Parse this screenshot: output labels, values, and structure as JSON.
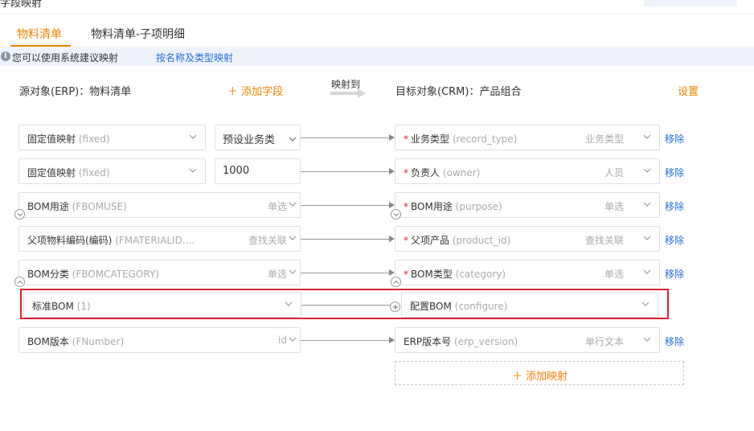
{
  "top": {
    "partial_title": "字段映射"
  },
  "tabs": [
    {
      "label": "物料清单",
      "active": true
    },
    {
      "label": "物料清单-子项明细",
      "active": false
    }
  ],
  "info": {
    "text": "您可以使用系统建议映射",
    "link": "按名称及类型映射"
  },
  "header": {
    "source": "源对象(ERP)：物料清单",
    "add_field": "＋ 添加字段",
    "mapping_to": "映射到",
    "target": "目标对象(CRM)：产品组合",
    "settings": "设置"
  },
  "rows": [
    {
      "src_label": "固定值映射",
      "src_api": "(fixed)",
      "src_type": "",
      "fixed_value": "预设业务类",
      "fixed_is_select": true,
      "tgt_required": true,
      "tgt_label": "业务类型",
      "tgt_api": "(record_type)",
      "tgt_type": "业务类型",
      "remove": "移除"
    },
    {
      "src_label": "固定值映射",
      "src_api": "(fixed)",
      "src_type": "",
      "fixed_value": "1000",
      "fixed_is_select": false,
      "tgt_required": true,
      "tgt_label": "负责人",
      "tgt_api": "(owner)",
      "tgt_type": "人员",
      "remove": "移除"
    },
    {
      "src_label": "BOM用途",
      "src_api": "(FBOMUSE)",
      "src_type": "单选",
      "tgt_required": true,
      "tgt_label": "BOM用途",
      "tgt_api": "(purpose)",
      "tgt_type": "单选",
      "remove": "移除"
    },
    {
      "src_label": "父项物料编码(编码)",
      "src_api": "(FMATERIALID....",
      "src_type": "查找关联",
      "tgt_required": true,
      "tgt_label": "父项产品",
      "tgt_api": "(product_id)",
      "tgt_type": "查找关联",
      "remove": "移除"
    },
    {
      "src_label": "BOM分类",
      "src_api": "(FBOMCATEGORY)",
      "src_type": "单选",
      "tgt_required": true,
      "tgt_label": "BOM类型",
      "tgt_api": "(category)",
      "tgt_type": "单选",
      "remove": "移除"
    },
    {
      "src_label": "标准BOM",
      "src_api": "(1)",
      "src_type": "",
      "tgt_required": false,
      "tgt_label": "配置BOM",
      "tgt_api": "(configure)",
      "tgt_type": "",
      "remove": "",
      "highlighted": true
    },
    {
      "src_label": "BOM版本",
      "src_api": "(FNumber)",
      "src_type": "id",
      "tgt_required": false,
      "tgt_label": "ERP版本号",
      "tgt_api": "(erp_version)",
      "tgt_type": "单行文本",
      "remove": "移除"
    }
  ],
  "add_mapping": "＋ 添加映射",
  "colors": {
    "accent": "#f08300",
    "link": "#1e6fd9",
    "required": "#e02020",
    "highlight": "#d9232e"
  }
}
